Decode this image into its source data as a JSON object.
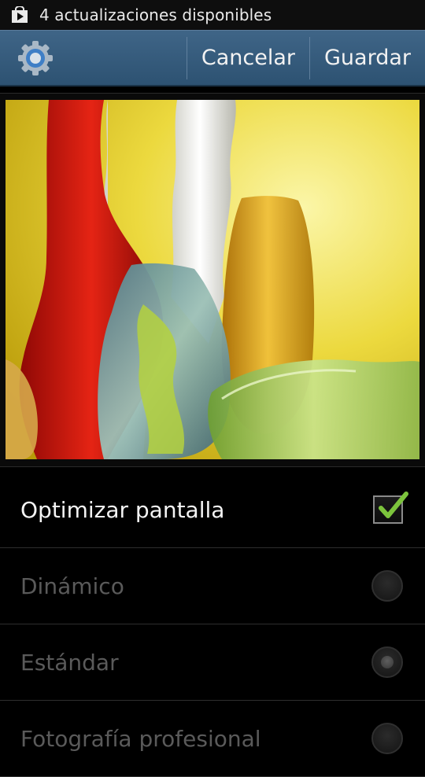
{
  "status_bar": {
    "notification_icon": "play-store-bag-icon",
    "text": "4 actualizaciones disponibles"
  },
  "action_bar": {
    "icon": "gear-icon",
    "cancel_label": "Cancelar",
    "save_label": "Guardar",
    "colors": {
      "bar": "#345a7c"
    }
  },
  "settings": {
    "optimize": {
      "label": "Optimizar pantalla",
      "checked": true,
      "check_color": "#7cc43c"
    },
    "modes": [
      {
        "label": "Dinámico",
        "selected": false,
        "enabled": false
      },
      {
        "label": "Estándar",
        "selected": true,
        "enabled": false
      },
      {
        "label": "Fotografía profesional",
        "selected": false,
        "enabled": false
      }
    ]
  }
}
